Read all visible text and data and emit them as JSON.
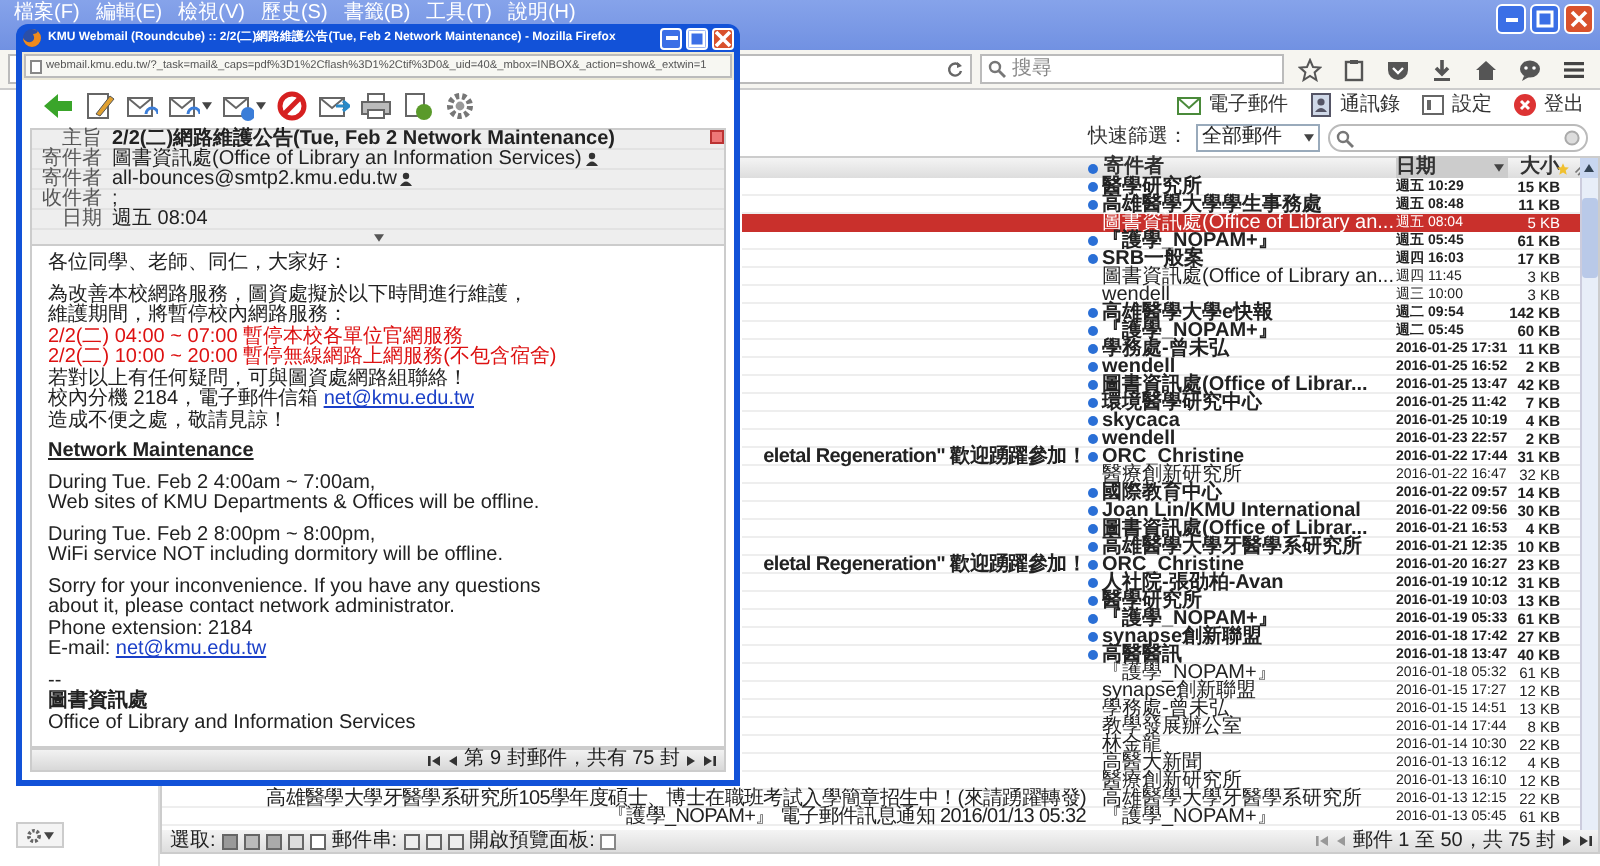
{
  "browser": {
    "menu": [
      "檔案(F)",
      "編輯(E)",
      "檢視(V)",
      "歷史(S)",
      "書籤(B)",
      "工具(T)",
      "說明(H)"
    ],
    "search_placeholder": "搜尋"
  },
  "webmail_toolbar": [
    {
      "label": "電子郵件"
    },
    {
      "label": "通訊錄"
    },
    {
      "label": "設定"
    },
    {
      "label": "登出"
    }
  ],
  "filter": {
    "label": "快速篩選：",
    "value": "全部郵件"
  },
  "list": {
    "columns": [
      "寄件者",
      "日期",
      "大小"
    ],
    "rows": [
      {
        "sender": "醫學研究所",
        "date": "週五 10:29",
        "size": "15 KB",
        "unread": true,
        "selected": false
      },
      {
        "sender": "高雄醫學大學學生事務處",
        "date": "週五 08:48",
        "size": "11 KB",
        "unread": true,
        "selected": false
      },
      {
        "sender": "圖書資訊處(Office of Library an...",
        "date": "週五 08:04",
        "size": "5 KB",
        "unread": false,
        "selected": true
      },
      {
        "sender": "『護學_NOPAM+』",
        "date": "週五 05:45",
        "size": "61 KB",
        "unread": true,
        "selected": false
      },
      {
        "sender": "SRB一般案",
        "date": "週四 16:03",
        "size": "17 KB",
        "unread": true,
        "selected": false
      },
      {
        "sender": "圖書資訊處(Office of Library an...",
        "date": "週四 11:45",
        "size": "3 KB",
        "unread": false,
        "selected": false
      },
      {
        "sender": "wendell",
        "date": "週三 10:00",
        "size": "3 KB",
        "unread": false,
        "selected": false
      },
      {
        "sender": "高雄醫學大學e快報",
        "date": "週二 09:54",
        "size": "142 KB",
        "unread": true,
        "selected": false
      },
      {
        "sender": "『護學_NOPAM+』",
        "date": "週二 05:45",
        "size": "60 KB",
        "unread": true,
        "selected": false
      },
      {
        "sender": "學務處-曾未弘",
        "date": "2016-01-25 17:31",
        "size": "11 KB",
        "unread": true,
        "selected": false
      },
      {
        "sender": "wendell",
        "date": "2016-01-25 16:52",
        "size": "2 KB",
        "unread": true,
        "selected": false
      },
      {
        "sender": "圖書資訊處(Office of Librar...",
        "date": "2016-01-25 13:47",
        "size": "42 KB",
        "unread": true,
        "selected": false
      },
      {
        "sender": "環境醫學研究中心",
        "date": "2016-01-25 11:42",
        "size": "7 KB",
        "unread": true,
        "selected": false
      },
      {
        "sender": "skycaca",
        "date": "2016-01-25 10:19",
        "size": "4 KB",
        "unread": true,
        "selected": false
      },
      {
        "sender": "wendell",
        "date": "2016-01-23 22:57",
        "size": "2 KB",
        "unread": true,
        "selected": false
      },
      {
        "subject": "eletal Regeneration\" 歡迎踴躍參加！",
        "sender": "ORC_Christine",
        "date": "2016-01-22 17:44",
        "size": "31 KB",
        "unread": true,
        "selected": false
      },
      {
        "sender": "醫療創新研究所",
        "date": "2016-01-22 16:47",
        "size": "32 KB",
        "unread": false,
        "selected": false
      },
      {
        "sender": "國際教育中心",
        "date": "2016-01-22 09:57",
        "size": "14 KB",
        "unread": true,
        "selected": false
      },
      {
        "sender": "Joan Lin/KMU International",
        "date": "2016-01-22 09:56",
        "size": "30 KB",
        "unread": true,
        "selected": false
      },
      {
        "sender": "圖書資訊處(Office of Librar...",
        "date": "2016-01-21 16:53",
        "size": "4 KB",
        "unread": true,
        "selected": false
      },
      {
        "sender": "高雄醫學大學牙醫學系研究所",
        "date": "2016-01-21 12:35",
        "size": "10 KB",
        "unread": true,
        "selected": false
      },
      {
        "subject": "eletal Regeneration\" 歡迎踴躍參加！",
        "sender": "ORC_Christine",
        "date": "2016-01-20 16:27",
        "size": "23 KB",
        "unread": true,
        "selected": false
      },
      {
        "sender": "人社院-張劭柏-Avan",
        "date": "2016-01-19 10:12",
        "size": "31 KB",
        "unread": true,
        "selected": false
      },
      {
        "sender": "醫學研究所",
        "date": "2016-01-19 10:03",
        "size": "13 KB",
        "unread": true,
        "selected": false
      },
      {
        "sender": "『護學_NOPAM+』",
        "date": "2016-01-19 05:33",
        "size": "61 KB",
        "unread": true,
        "selected": false
      },
      {
        "sender": "synapse創新聯盟",
        "date": "2016-01-18 17:42",
        "size": "27 KB",
        "unread": true,
        "selected": false
      },
      {
        "sender": "高醫醫訊",
        "date": "2016-01-18 13:47",
        "size": "40 KB",
        "unread": true,
        "selected": false
      },
      {
        "sender": "『護學_NOPAM+』",
        "date": "2016-01-18 05:32",
        "size": "61 KB",
        "unread": false,
        "selected": false
      },
      {
        "sender": "synapse創新聯盟",
        "date": "2016-01-15 17:27",
        "size": "12 KB",
        "unread": false,
        "selected": false
      },
      {
        "sender": "學務處-曾未弘",
        "date": "2016-01-15 14:51",
        "size": "13 KB",
        "unread": false,
        "selected": false
      },
      {
        "sender": "教學發展辦公室",
        "date": "2016-01-14 17:44",
        "size": "8 KB",
        "unread": false,
        "selected": false
      },
      {
        "sender": "林金龍",
        "date": "2016-01-14 10:30",
        "size": "22 KB",
        "unread": false,
        "selected": false
      },
      {
        "sender": "高醫大新聞",
        "date": "2016-01-13 16:12",
        "size": "4 KB",
        "unread": false,
        "selected": false
      },
      {
        "sender": "醫療創新研究所",
        "date": "2016-01-13 16:10",
        "size": "12 KB",
        "unread": false,
        "selected": false
      },
      {
        "subject": "高雄醫學大學牙醫學系研究所105學年度碩士、博士在職班考試入學簡章招生中！(來請踴躍轉發)",
        "sender": "高雄醫學大學牙醫學系研究所",
        "date": "2016-01-13 12:15",
        "size": "22 KB",
        "unread": false,
        "selected": false
      },
      {
        "subject": "『護學_NOPAM+』 電子郵件訊息通知 2016/01/13 05:32",
        "sender": "『護學_NOPAM+』",
        "date": "2016-01-13 05:45",
        "size": "61 KB",
        "unread": false,
        "selected": false
      }
    ],
    "pagination": "郵件 1 至 50，共 75 封"
  },
  "bottom_bar": {
    "select_label": "選取:",
    "thread_label": "郵件串:",
    "preview_label": "開啟預覽面板:",
    "preview_pane": false
  },
  "popup": {
    "title": "KMU Webmail (Roundcube) :: 2/2(二)網路維護公告(Tue, Feb 2 Network Maintenance) - Mozilla Firefox",
    "url": "webmail.kmu.edu.tw/?_task=mail&_caps=pdf%3D1%2Cflash%3D1%2Ctif%3D0&_uid=40&_mbox=INBOX&_action=show&_extwin=1",
    "headers": [
      {
        "kind": "subject",
        "label": "主旨",
        "value": "2/2(二)網路維護公告(Tue, Feb 2 Network Maintenance)"
      },
      {
        "kind": "contact",
        "label": "寄件者",
        "value": "圖書資訊處(Office of Library an Information Services)"
      },
      {
        "kind": "contact",
        "label": "寄件者",
        "value": "all-bounces@smtp2.kmu.edu.tw"
      },
      {
        "kind": "plain",
        "label": "收件者",
        "value": ";"
      },
      {
        "kind": "plain",
        "label": "日期",
        "value": "週五 08:04"
      }
    ],
    "body": [
      {
        "kind": "text",
        "text": "各位同學、老師、同仁，大家好："
      },
      {
        "kind": "gap"
      },
      {
        "kind": "text",
        "text": "為改善本校網路服務，圖資處擬於以下時間進行維護，"
      },
      {
        "kind": "text",
        "text": "維護期間，將暫停校內網路服務："
      },
      {
        "kind": "alert",
        "text": "2/2(二) 04:00 ~ 07:00 暫停本校各單位官網服務"
      },
      {
        "kind": "alert",
        "text": "2/2(二) 10:00 ~ 20:00 暫停無線網路上網服務(不包含宿舍)"
      },
      {
        "kind": "text",
        "text": "若對以上有任何疑問，可與圖資處網路組聯絡！"
      },
      {
        "kind": "link",
        "text": "校內分機 2184，電子郵件信箱 ",
        "link": "net@kmu.edu.tw"
      },
      {
        "kind": "text",
        "text": "造成不便之處，敬請見諒！"
      },
      {
        "kind": "gap"
      },
      {
        "kind": "heading",
        "text": "Network Maintenance"
      },
      {
        "kind": "gap"
      },
      {
        "kind": "text",
        "text": "During Tue. Feb 2 4:00am ~ 7:00am,"
      },
      {
        "kind": "text",
        "text": "Web sites of KMU Departments & Offices will be offline."
      },
      {
        "kind": "gap"
      },
      {
        "kind": "text",
        "text": "During Tue. Feb 2 8:00pm ~ 8:00pm,"
      },
      {
        "kind": "text",
        "text": "WiFi service NOT including dormitory will be offline."
      },
      {
        "kind": "gap"
      },
      {
        "kind": "text",
        "text": "Sorry for your inconvenience. If you have any questions"
      },
      {
        "kind": "text",
        "text": "about it, please contact network administrator."
      },
      {
        "kind": "text",
        "text": "Phone extension: 2184"
      },
      {
        "kind": "link",
        "text": "E-mail: ",
        "link": "net@kmu.edu.tw"
      },
      {
        "kind": "gap"
      },
      {
        "kind": "text",
        "text": "--"
      },
      {
        "kind": "signature",
        "text": "圖書資訊處"
      },
      {
        "kind": "text",
        "text": "Office of Library and Information Services"
      }
    ],
    "pagination": "第 9 封郵件，共有 75 封"
  }
}
